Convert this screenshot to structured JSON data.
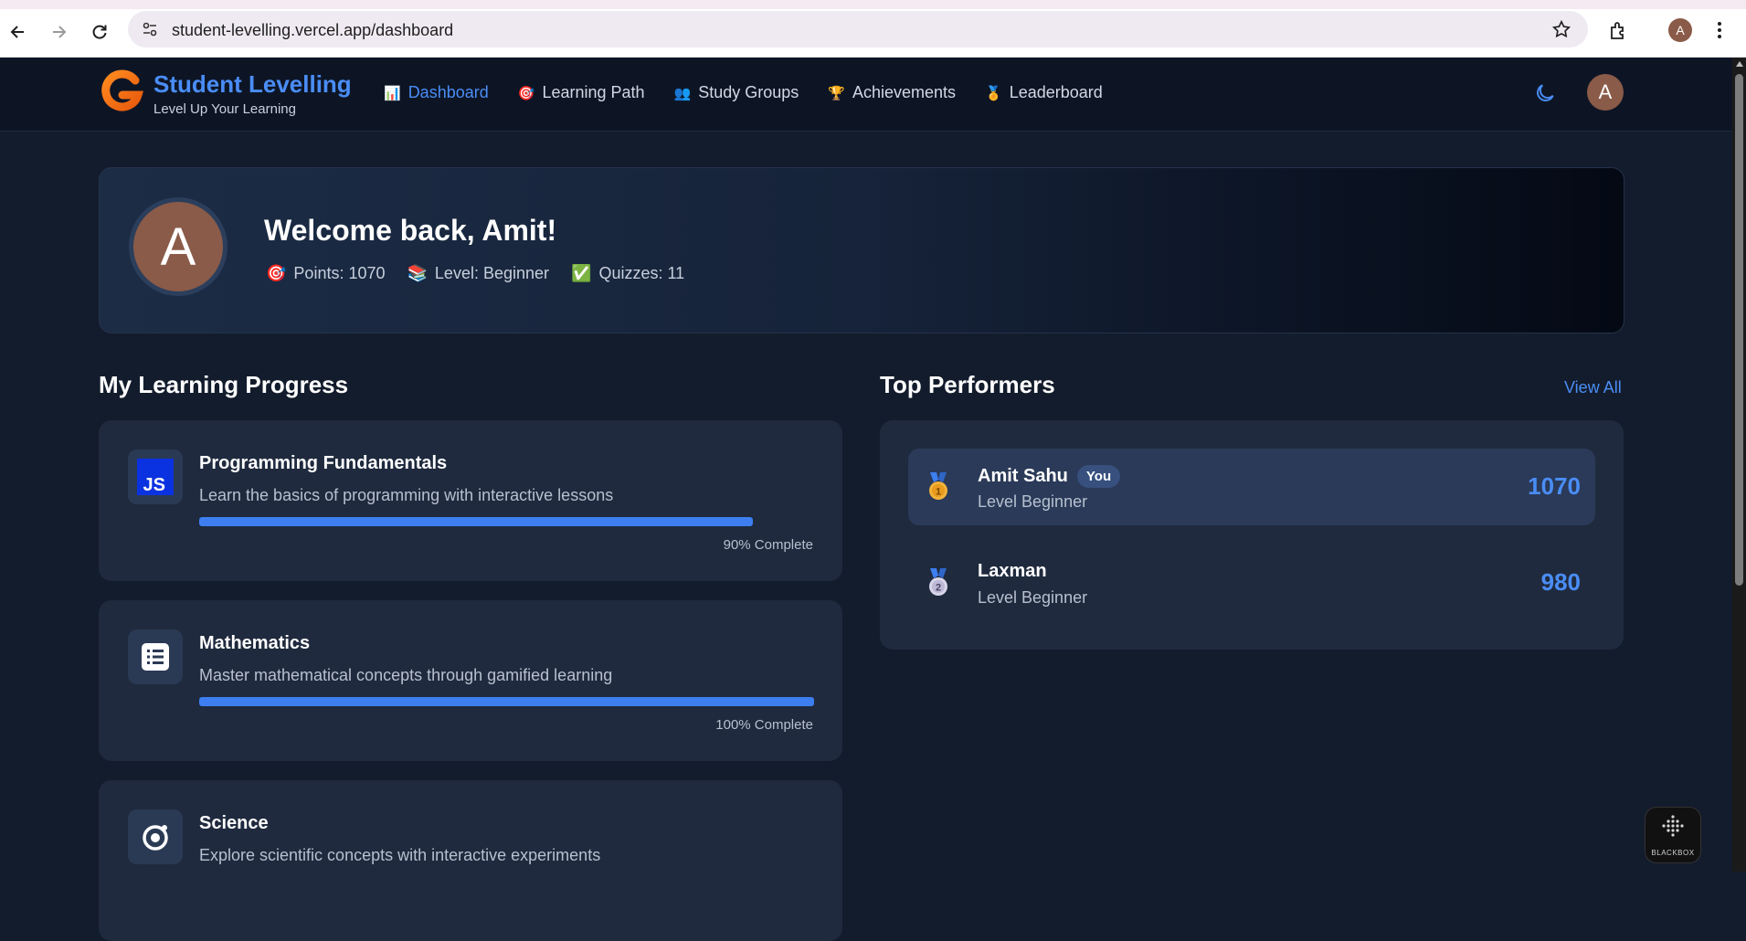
{
  "browser": {
    "url": "student-levelling.vercel.app/dashboard",
    "profile_initial": "A"
  },
  "header": {
    "brand_title": "Student Levelling",
    "brand_subtitle": "Level Up Your Learning",
    "nav": [
      {
        "label": "Dashboard",
        "icon": "📊",
        "active": true
      },
      {
        "label": "Learning Path",
        "icon": "🎯",
        "active": false
      },
      {
        "label": "Study Groups",
        "icon": "👥",
        "active": false
      },
      {
        "label": "Achievements",
        "icon": "🏆",
        "active": false
      },
      {
        "label": "Leaderboard",
        "icon": "🏅",
        "active": false
      }
    ],
    "avatar_initial": "A"
  },
  "welcome": {
    "avatar_initial": "A",
    "title": "Welcome back, Amit!",
    "stats": [
      {
        "icon": "🎯",
        "text": "Points: 1070"
      },
      {
        "icon": "📚",
        "text": "Level: Beginner"
      },
      {
        "icon": "✅",
        "text": "Quizzes: 11"
      }
    ]
  },
  "progress": {
    "title": "My Learning Progress",
    "courses": [
      {
        "icon": "js-icon",
        "title": "Programming Fundamentals",
        "description": "Learn the basics of programming with interactive lessons",
        "progress": 0.9,
        "progress_label": "90% Complete"
      },
      {
        "icon": "list-icon",
        "title": "Mathematics",
        "description": "Master mathematical concepts through gamified learning",
        "progress": 1.0,
        "progress_label": "100% Complete"
      },
      {
        "icon": "atom-icon",
        "title": "Science",
        "description": "Explore scientific concepts with interactive experiments"
      }
    ]
  },
  "performers": {
    "title": "Top Performers",
    "view_all": "View All",
    "rows": [
      {
        "rank": "1",
        "name": "Amit Sahu",
        "badge": "You",
        "level": "Level Beginner",
        "points": "1070"
      },
      {
        "rank": "2",
        "name": "Laxman",
        "level": "Level Beginner",
        "points": "980"
      }
    ]
  },
  "widget": {
    "label": "BLACKBOX"
  },
  "colors": {
    "accent": "#4a8df6",
    "background": "#131c2c",
    "card": "#1f2a3e"
  }
}
